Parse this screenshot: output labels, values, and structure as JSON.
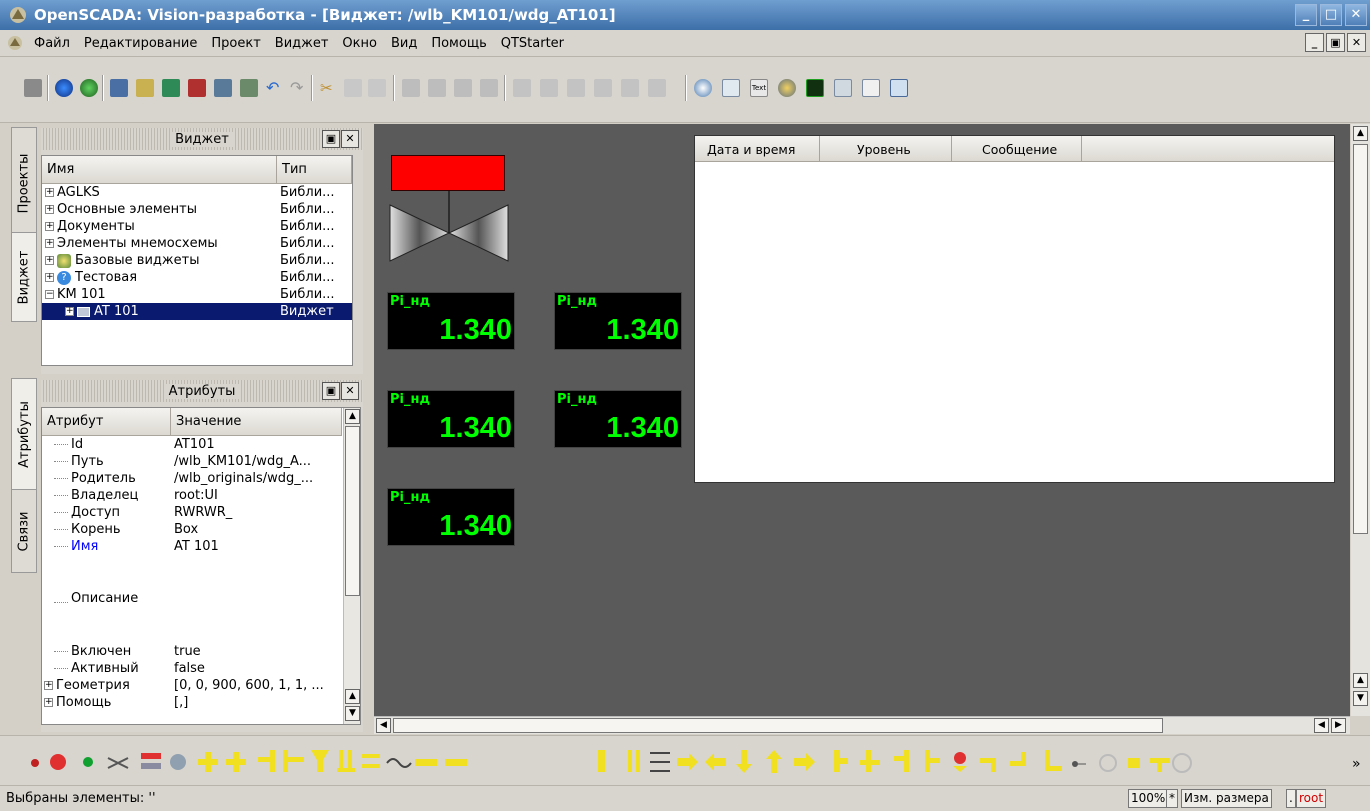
{
  "window": {
    "title": "OpenSCADA: Vision-разработка - [Виджет: /wlb_KM101/wdg_AT101]"
  },
  "menu": [
    "Файл",
    "Редактирование",
    "Проект",
    "Виджет",
    "Окно",
    "Вид",
    "Помощь",
    "QTStarter"
  ],
  "side_tabs": [
    "Проекты",
    "Виджет",
    "Атрибуты",
    "Связи"
  ],
  "widget_dock": {
    "title": "Виджет",
    "columns": [
      "Имя",
      "Тип"
    ],
    "rows": [
      {
        "name": "AGLKS",
        "type": "Библи..."
      },
      {
        "name": "Основные элементы",
        "type": "Библи..."
      },
      {
        "name": "Документы",
        "type": "Библи..."
      },
      {
        "name": "Элементы мнемосхемы",
        "type": "Библи..."
      },
      {
        "name": "Базовые виджеты",
        "type": "Библи..."
      },
      {
        "name": "Тестовая",
        "type": "Библи..."
      },
      {
        "name": "KM 101",
        "type": "Библи..."
      },
      {
        "name": "AT 101",
        "type": "Виджет"
      }
    ]
  },
  "attr_dock": {
    "title": "Атрибуты",
    "columns": [
      "Атрибут",
      "Значение"
    ],
    "rows": [
      {
        "name": "Id",
        "value": "AT101"
      },
      {
        "name": "Путь",
        "value": "/wlb_KM101/wdg_A..."
      },
      {
        "name": "Родитель",
        "value": "/wlb_originals/wdg_..."
      },
      {
        "name": "Владелец",
        "value": "root:UI"
      },
      {
        "name": "Доступ",
        "value": "RWRWR_"
      },
      {
        "name": "Корень",
        "value": "Box"
      },
      {
        "name": "Имя",
        "value": "AT 101"
      },
      {
        "name": "Описание",
        "value": ""
      },
      {
        "name": "Включен",
        "value": "true"
      },
      {
        "name": "Активный",
        "value": "false"
      },
      {
        "name": "Геометрия",
        "value": "[0, 0, 900, 600, 1, 1, ..."
      },
      {
        "name": "Помощь",
        "value": "[,]"
      }
    ]
  },
  "canvas": {
    "displays": [
      {
        "label": "Pi_нд",
        "value": "1.340"
      },
      {
        "label": "Pi_нд",
        "value": "1.340"
      },
      {
        "label": "Pi_нд",
        "value": "1.340"
      },
      {
        "label": "Pi_нд",
        "value": "1.340"
      },
      {
        "label": "Pi_нд",
        "value": "1.340"
      }
    ],
    "protocol_columns": [
      "Дата и время",
      "Уровень",
      "Сообщение"
    ]
  },
  "status": {
    "text": "Выбраны элементы: ''",
    "zoom": "100%",
    "modified": "*",
    "mode": "Изм. размера",
    "dot": ".",
    "user": "root"
  },
  "colors": {
    "selection": "#0a1a6e",
    "valve_head": "#ff0000",
    "display_text": "#00ff00",
    "canvas_bg": "#5a5a5a",
    "attr_highlight": "#0000ff"
  }
}
